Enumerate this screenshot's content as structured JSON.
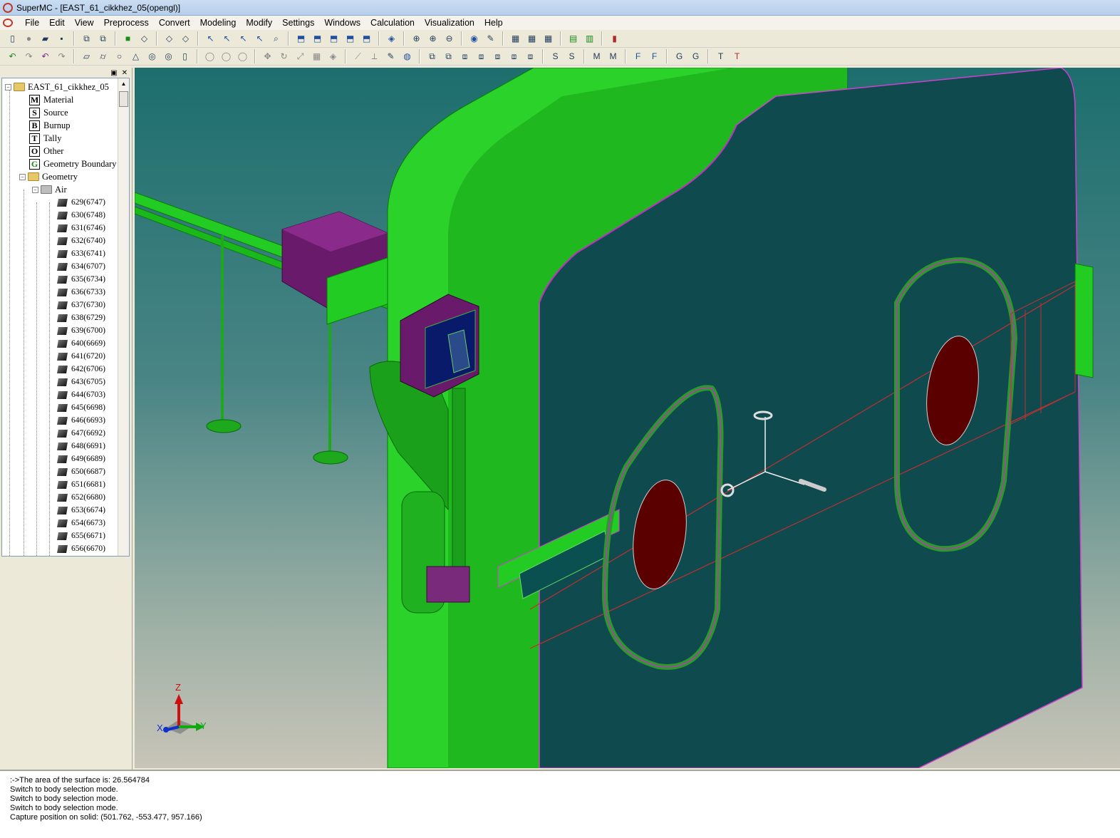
{
  "window": {
    "title": "SuperMC - [EAST_61_cikkhez_05(opengl)]"
  },
  "menubar": {
    "items": [
      "File",
      "Edit",
      "View",
      "Preprocess",
      "Convert",
      "Modeling",
      "Modify",
      "Settings",
      "Windows",
      "Calculation",
      "Visualization",
      "Help"
    ]
  },
  "tree": {
    "root": "EAST_61_cikkhez_05",
    "categories": [
      {
        "letter": "M",
        "label": "Material"
      },
      {
        "letter": "S",
        "label": "Source"
      },
      {
        "letter": "B",
        "label": "Burnup"
      },
      {
        "letter": "T",
        "label": "Tally"
      },
      {
        "letter": "O",
        "label": "Other"
      },
      {
        "letter": "G",
        "label": "Geometry Boundary"
      }
    ],
    "geometry_label": "Geometry",
    "group_label": "Air",
    "cells": [
      "629(6747)",
      "630(6748)",
      "631(6746)",
      "632(6740)",
      "633(6741)",
      "634(6707)",
      "635(6734)",
      "636(6733)",
      "637(6730)",
      "638(6729)",
      "639(6700)",
      "640(6669)",
      "641(6720)",
      "642(6706)",
      "643(6705)",
      "644(6703)",
      "645(6698)",
      "646(6693)",
      "647(6692)",
      "648(6691)",
      "649(6689)",
      "650(6687)",
      "651(6681)",
      "652(6680)",
      "653(6674)",
      "654(6673)",
      "655(6671)",
      "656(6670)"
    ]
  },
  "axes": {
    "z": "Z",
    "x": "X",
    "y": "Y"
  },
  "console": {
    "lines": [
      ":->The area of the surface is: 26.564784",
      "Switch to body selection mode.",
      "Switch to body selection mode.",
      "Switch to body selection mode.",
      "Capture position on solid: (501.762, -553.477, 957.166)"
    ]
  },
  "colors": {
    "viewport_top": "#1d6e6e",
    "model_green": "#22cc22",
    "panel_teal": "#0e4a4e",
    "port_red": "#5a0000",
    "magenta": "#7a1a7a"
  }
}
